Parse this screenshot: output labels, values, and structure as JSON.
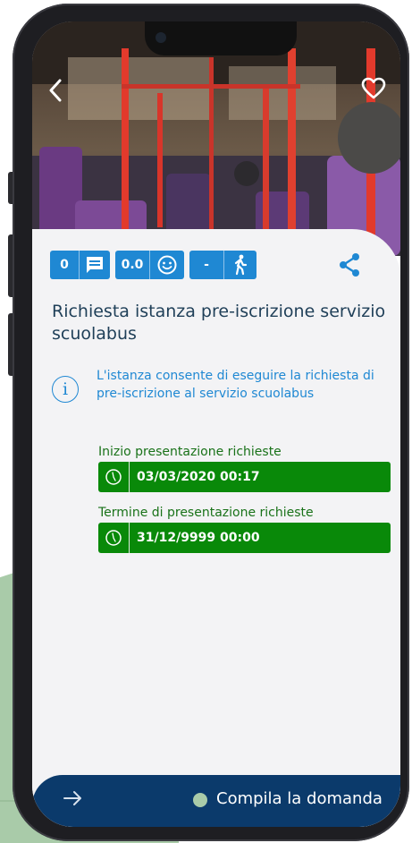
{
  "stats": {
    "comments_count": "0",
    "comments_icon": "comment-icon",
    "rating": "0.0",
    "rating_icon": "smiley-icon",
    "level": "-",
    "level_icon": "walking-person-icon"
  },
  "header": {
    "back_icon": "chevron-left-icon",
    "favorite_icon": "heart-icon",
    "share_icon": "share-icon"
  },
  "service": {
    "title": "Richiesta istanza pre-iscrizione servizio scuolabus",
    "description": "L'istanza consente di eseguire la richiesta di pre-iscrizione al servizio scuolabus"
  },
  "dates": [
    {
      "label": "Inizio presentazione richieste",
      "value": "03/03/2020 00:17"
    },
    {
      "label": "Termine di presentazione richieste",
      "value": "31/12/9999 00:00"
    }
  ],
  "footer": {
    "action_label": "Compila la domanda",
    "arrow_icon": "arrow-right-icon"
  },
  "colors": {
    "primary": "#1f88d3",
    "title": "#1f3f58",
    "success": "#098909",
    "footer": "#0b3a6b",
    "card_bg": "#f3f3f5"
  }
}
